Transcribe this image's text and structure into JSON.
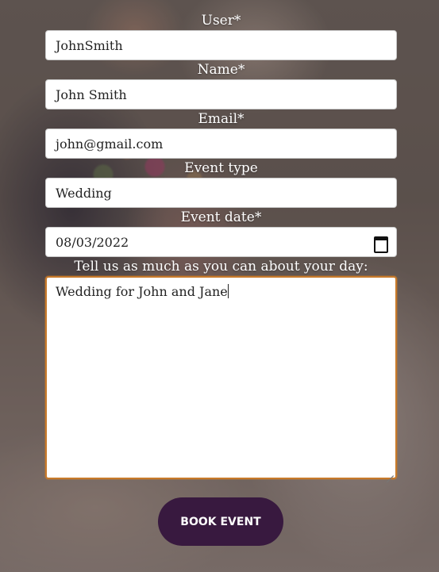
{
  "form": {
    "fields": [
      {
        "label": "User*",
        "value": "JohnSmith"
      },
      {
        "label": "Name*",
        "value": "John Smith"
      },
      {
        "label": "Email*",
        "value": "john@gmail.com"
      },
      {
        "label": "Event type",
        "value": "Wedding"
      },
      {
        "label": "Event date*",
        "value": "08/03/2022"
      }
    ],
    "details": {
      "label": "Tell us as much as you can about your day:",
      "value": "Wedding for John and Jane"
    },
    "submit_label": "BOOK EVENT"
  },
  "icons": {
    "calendar": "calendar-icon",
    "resize": "resize-handle-icon"
  },
  "colors": {
    "button_bg": "#38193f",
    "button_text": "#ffffff",
    "textarea_focus_border": "#c87a2a",
    "label_text": "#ffffff"
  }
}
